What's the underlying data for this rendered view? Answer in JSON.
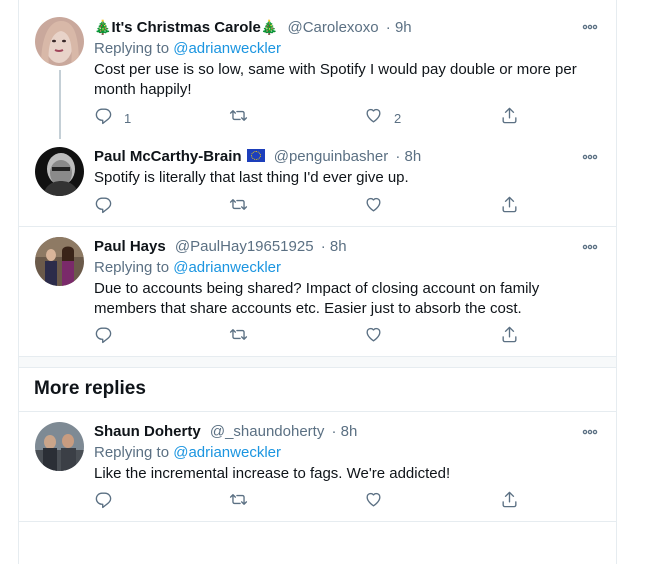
{
  "tweets": [
    {
      "name": "It's Christmas Carole",
      "name_prefix_emoji": "🎄",
      "name_suffix_emoji": "🎄",
      "handle": "@Carolexoxo",
      "time": "· 9h",
      "replying_label": "Replying to",
      "replying_to": "@adrianweckler",
      "text": "Cost per use is so low, same with Spotify I would pay double or more per month happily!",
      "reply_count": "1",
      "retweet_count": "",
      "like_count": "2"
    },
    {
      "name": "Paul McCarthy-Brain",
      "flag": "eu-flag",
      "handle": "@penguinbasher",
      "time": "· 8h",
      "text": "Spotify is literally that last thing I'd ever give up.",
      "reply_count": "",
      "retweet_count": "",
      "like_count": ""
    },
    {
      "name": "Paul Hays",
      "handle": "@PaulHay19651925",
      "time": "· 8h",
      "replying_label": "Replying to",
      "replying_to": "@adrianweckler",
      "text": "Due to accounts being shared? Impact of closing account on family members that share accounts etc. Easier just to absorb the cost.",
      "reply_count": "",
      "retweet_count": "",
      "like_count": ""
    },
    {
      "name": "Shaun Doherty",
      "handle": "@_shaundoherty",
      "time": "· 8h",
      "replying_label": "Replying to",
      "replying_to": "@adrianweckler",
      "text": "Like the incremental increase to fags. We're addicted!",
      "reply_count": "",
      "retweet_count": "",
      "like_count": ""
    }
  ],
  "more_replies_heading": "More replies",
  "icons": {
    "reply": "reply-icon",
    "retweet": "retweet-icon",
    "like": "heart-icon",
    "share": "share-icon",
    "more": "more-options-icon"
  },
  "colors": {
    "link": "#1b95e0",
    "secondary": "#5b7083",
    "border": "#e6ecf0"
  }
}
